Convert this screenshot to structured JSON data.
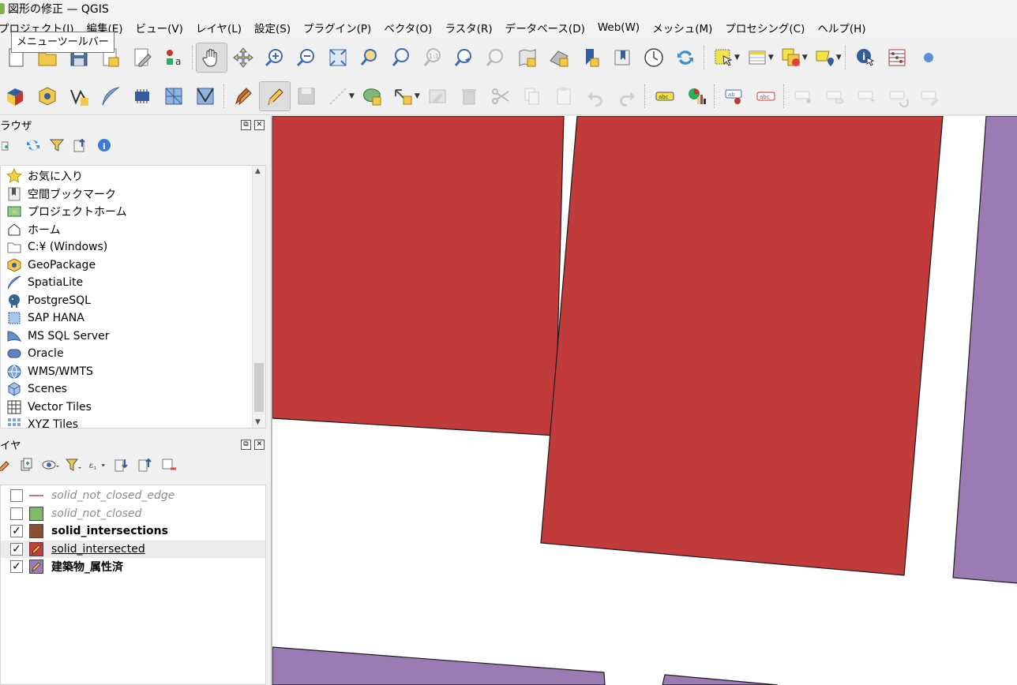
{
  "window": {
    "title": "図形の修正 — QGIS"
  },
  "menubar": {
    "items": [
      "プロジェクト(J)",
      "編集(E)",
      "ビュー(V)",
      "レイヤ(L)",
      "設定(S)",
      "プラグイン(P)",
      "ベクタ(O)",
      "ラスタ(R)",
      "データベース(D)",
      "Web(W)",
      "メッシュ(M)",
      "プロセシング(C)",
      "ヘルプ(H)"
    ]
  },
  "tooltip": {
    "text": "メニューツールバー"
  },
  "browser_panel": {
    "title": "ラウザ",
    "items": [
      {
        "label": "お気に入り",
        "icon": "star-icon"
      },
      {
        "label": "空間ブックマーク",
        "icon": "bookmark-icon"
      },
      {
        "label": "プロジェクトホーム",
        "icon": "project-home-icon"
      },
      {
        "label": "ホーム",
        "icon": "home-icon"
      },
      {
        "label": "C:¥ (Windows)",
        "icon": "folder-icon"
      },
      {
        "label": "GeoPackage",
        "icon": "geopackage-icon"
      },
      {
        "label": "SpatiaLite",
        "icon": "spatialite-icon"
      },
      {
        "label": "PostgreSQL",
        "icon": "postgresql-icon"
      },
      {
        "label": "SAP HANA",
        "icon": "sap-hana-icon"
      },
      {
        "label": "MS SQL Server",
        "icon": "mssql-icon"
      },
      {
        "label": "Oracle",
        "icon": "oracle-icon"
      },
      {
        "label": "WMS/WMTS",
        "icon": "wms-icon"
      },
      {
        "label": "Scenes",
        "icon": "scenes-icon"
      },
      {
        "label": "Vector Tiles",
        "icon": "vector-tiles-icon"
      },
      {
        "label": "XYZ Tiles",
        "icon": "xyz-tiles-icon"
      }
    ]
  },
  "layers_panel": {
    "title": "イヤ",
    "layers": [
      {
        "name": "solid_not_closed_edge",
        "checked": false,
        "symbol": "line",
        "color": "#d16a9a",
        "state": "disabled"
      },
      {
        "name": "solid_not_closed",
        "checked": false,
        "symbol": "fill",
        "color": "#7dba6a",
        "state": "disabled"
      },
      {
        "name": "solid_intersections",
        "checked": true,
        "symbol": "fill",
        "color": "#8b4f2e",
        "state": "bold"
      },
      {
        "name": "solid_intersected",
        "checked": true,
        "symbol": "editing",
        "color": "#c43c3c",
        "state": "current"
      },
      {
        "name": "建築物_属性済",
        "checked": true,
        "symbol": "editing",
        "color": "#9a7cb8",
        "state": "bold"
      }
    ],
    "checkmark": "✓"
  },
  "map": {
    "colors": {
      "red_fill": "#c23b3b",
      "purple_fill": "#9b7bb4",
      "brown_fill": "#7a4a25",
      "outline": "#1a1a1a",
      "background": "#ffffff"
    }
  }
}
